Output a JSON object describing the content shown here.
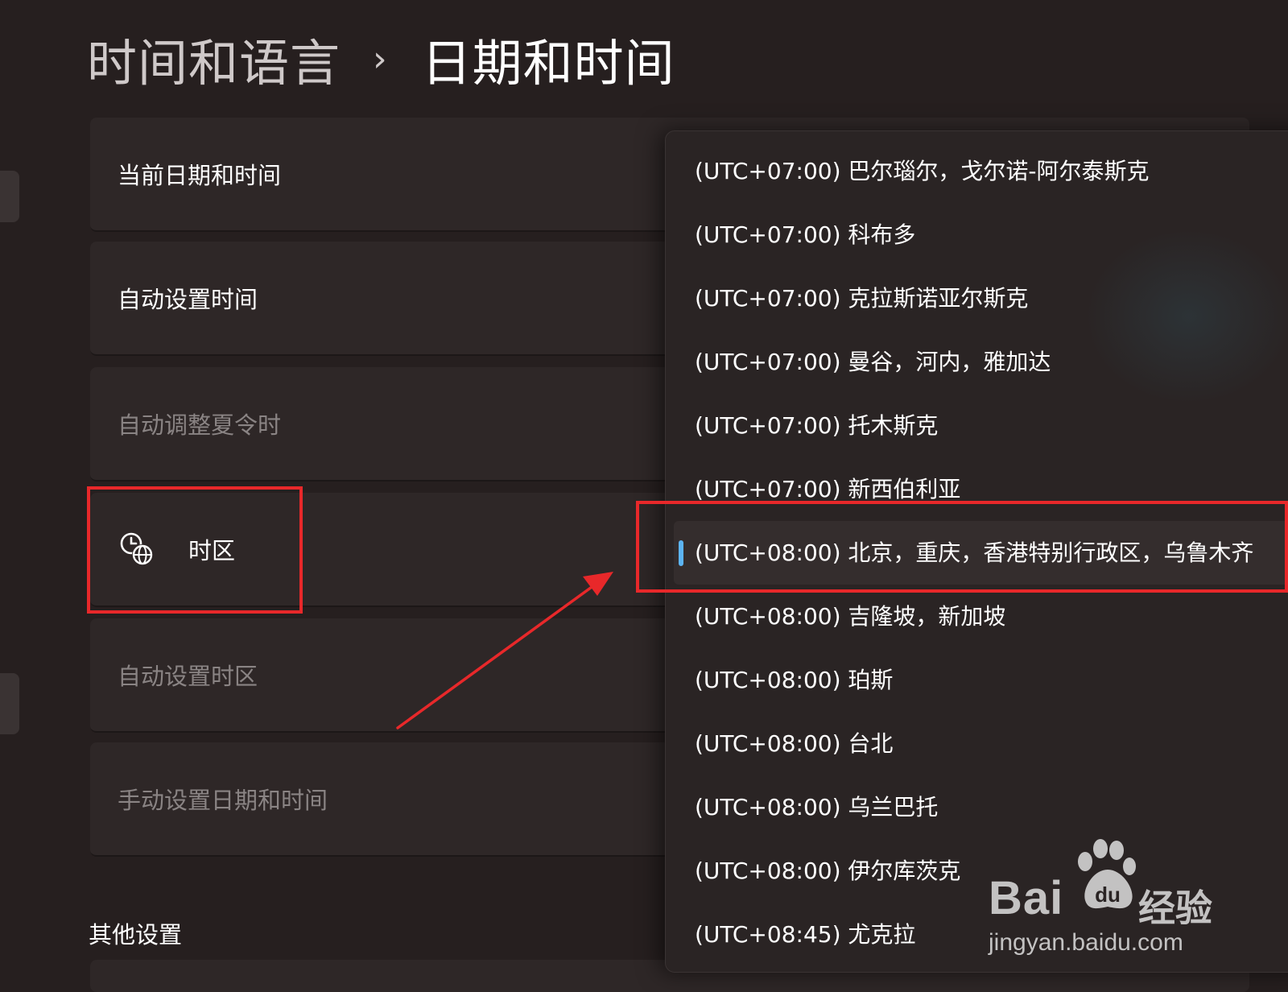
{
  "breadcrumb": {
    "parent": "时间和语言",
    "separator": "›",
    "current": "日期和时间"
  },
  "settings": {
    "current_datetime": "当前日期和时间",
    "auto_set_time": "自动设置时间",
    "auto_dst": "自动调整夏令时",
    "time_zone": "时区",
    "auto_set_timezone": "自动设置时区",
    "manual_set": "手动设置日期和时间"
  },
  "section": {
    "other_settings": "其他设置"
  },
  "timezone_dropdown": {
    "items": [
      "(UTC+07:00) 巴尔瑙尔，戈尔诺-阿尔泰斯克",
      "(UTC+07:00) 科布多",
      "(UTC+07:00) 克拉斯诺亚尔斯克",
      "(UTC+07:00) 曼谷，河内，雅加达",
      "(UTC+07:00) 托木斯克",
      "(UTC+07:00) 新西伯利亚",
      "(UTC+08:00) 北京，重庆，香港特别行政区，乌鲁木齐",
      "(UTC+08:00) 吉隆坡，新加坡",
      "(UTC+08:00) 珀斯",
      "(UTC+08:00) 台北",
      "(UTC+08:00) 乌兰巴托",
      "(UTC+08:00) 伊尔库茨克",
      "(UTC+08:45) 尤克拉"
    ],
    "selected_index": 6
  },
  "watermark": {
    "brand_left": "Bai",
    "brand_inner": "du",
    "label": "经验",
    "url": "jingyan.baidu.com"
  },
  "colors": {
    "background": "#261f1f",
    "card": "#2e2727",
    "dropdown": "#2a2424",
    "accent": "#5cb4f4",
    "annotation": "#e8282a"
  }
}
